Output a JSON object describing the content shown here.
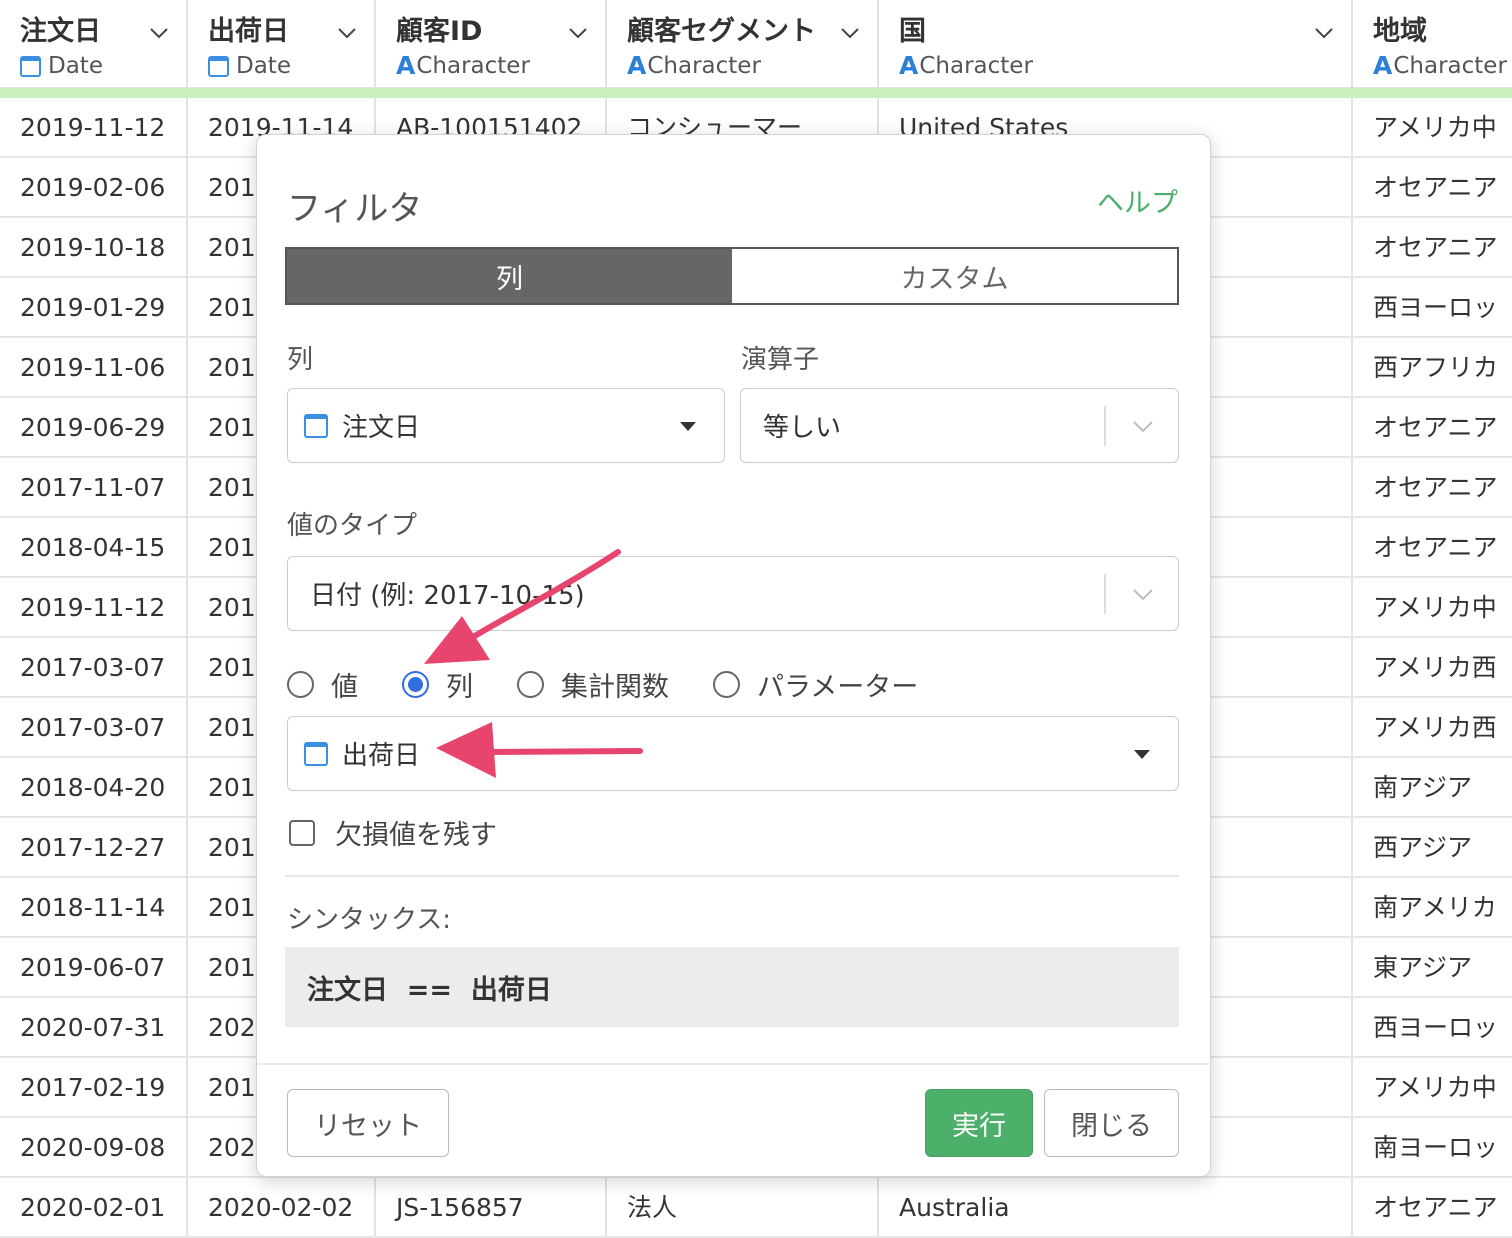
{
  "columns": [
    {
      "title": "注文日",
      "type": "Date",
      "type_icon": "calendar-icon",
      "cells": [
        "2019-11-12",
        "2019-02-06",
        "2019-10-18",
        "2019-01-29",
        "2019-11-06",
        "2019-06-29",
        "2017-11-07",
        "2018-04-15",
        "2019-11-12",
        "2017-03-07",
        "2017-03-07",
        "2018-04-20",
        "2017-12-27",
        "2018-11-14",
        "2019-06-07",
        "2020-07-31",
        "2017-02-19",
        "2020-09-08",
        "2020-02-01"
      ]
    },
    {
      "title": "出荷日",
      "type": "Date",
      "type_icon": "calendar-icon",
      "cells": [
        "2019-11-14",
        "201",
        "201",
        "201",
        "201",
        "201",
        "201",
        "201",
        "201",
        "201",
        "201",
        "201",
        "201",
        "201",
        "201",
        "202",
        "201",
        "202",
        "2020-02-02"
      ]
    },
    {
      "title": "顧客ID",
      "type": "Character",
      "type_icon": "character-icon",
      "cells": [
        "AB-100151402",
        "",
        "",
        "",
        "",
        "",
        "",
        "",
        "",
        "",
        "",
        "",
        "",
        "",
        "",
        "",
        "",
        "",
        "JS-156857"
      ]
    },
    {
      "title": "顧客セグメント",
      "type": "Character",
      "type_icon": "character-icon",
      "cells": [
        "コンシューマー",
        "",
        "",
        "",
        "",
        "",
        "",
        "",
        "",
        "",
        "",
        "",
        "",
        "",
        "",
        "",
        "",
        "",
        "法人"
      ]
    },
    {
      "title": "国",
      "type": "Character",
      "type_icon": "character-icon",
      "cells": [
        "United States",
        "",
        "",
        "",
        "",
        "",
        "",
        "",
        "",
        "",
        "",
        "",
        "",
        "",
        "",
        "",
        "",
        "",
        "Australia"
      ]
    },
    {
      "title": "地域",
      "type": "Character",
      "type_icon": "character-icon",
      "cells": [
        "アメリカ中",
        "オセアニア",
        "オセアニア",
        "西ヨーロッ",
        "西アフリカ",
        "オセアニア",
        "オセアニア",
        "オセアニア",
        "アメリカ中",
        "アメリカ西",
        "アメリカ西",
        "南アジア",
        "西アジア",
        "南アメリカ",
        "東アジア",
        "西ヨーロッ",
        "アメリカ中",
        "南ヨーロッ",
        "オセアニア"
      ]
    }
  ],
  "dialog": {
    "title": "フィルタ",
    "help": "ヘルプ",
    "tabs": {
      "column": "列",
      "custom": "カスタム"
    },
    "column_label": "列",
    "column_value": "注文日",
    "operator_label": "演算子",
    "operator_value": "等しい",
    "value_type_label": "値のタイプ",
    "value_type_value": "日付 (例: 2017-10-15)",
    "radios": {
      "value": "値",
      "column": "列",
      "aggregate": "集計関数",
      "parameter": "パラメーター",
      "selected": "列"
    },
    "target_column": "出荷日",
    "keep_missing": "欠損値を残す",
    "keep_missing_checked": false,
    "syntax_label": "シンタックス:",
    "syntax": "注文日  ==  出荷日",
    "reset": "リセット",
    "run": "実行",
    "close": "閉じる"
  },
  "colors": {
    "accent_green": "#4caf6a",
    "annotation_arrow": "#e8456e",
    "radio_blue": "#2f6fe0",
    "header_bar": "#c8efbd"
  }
}
